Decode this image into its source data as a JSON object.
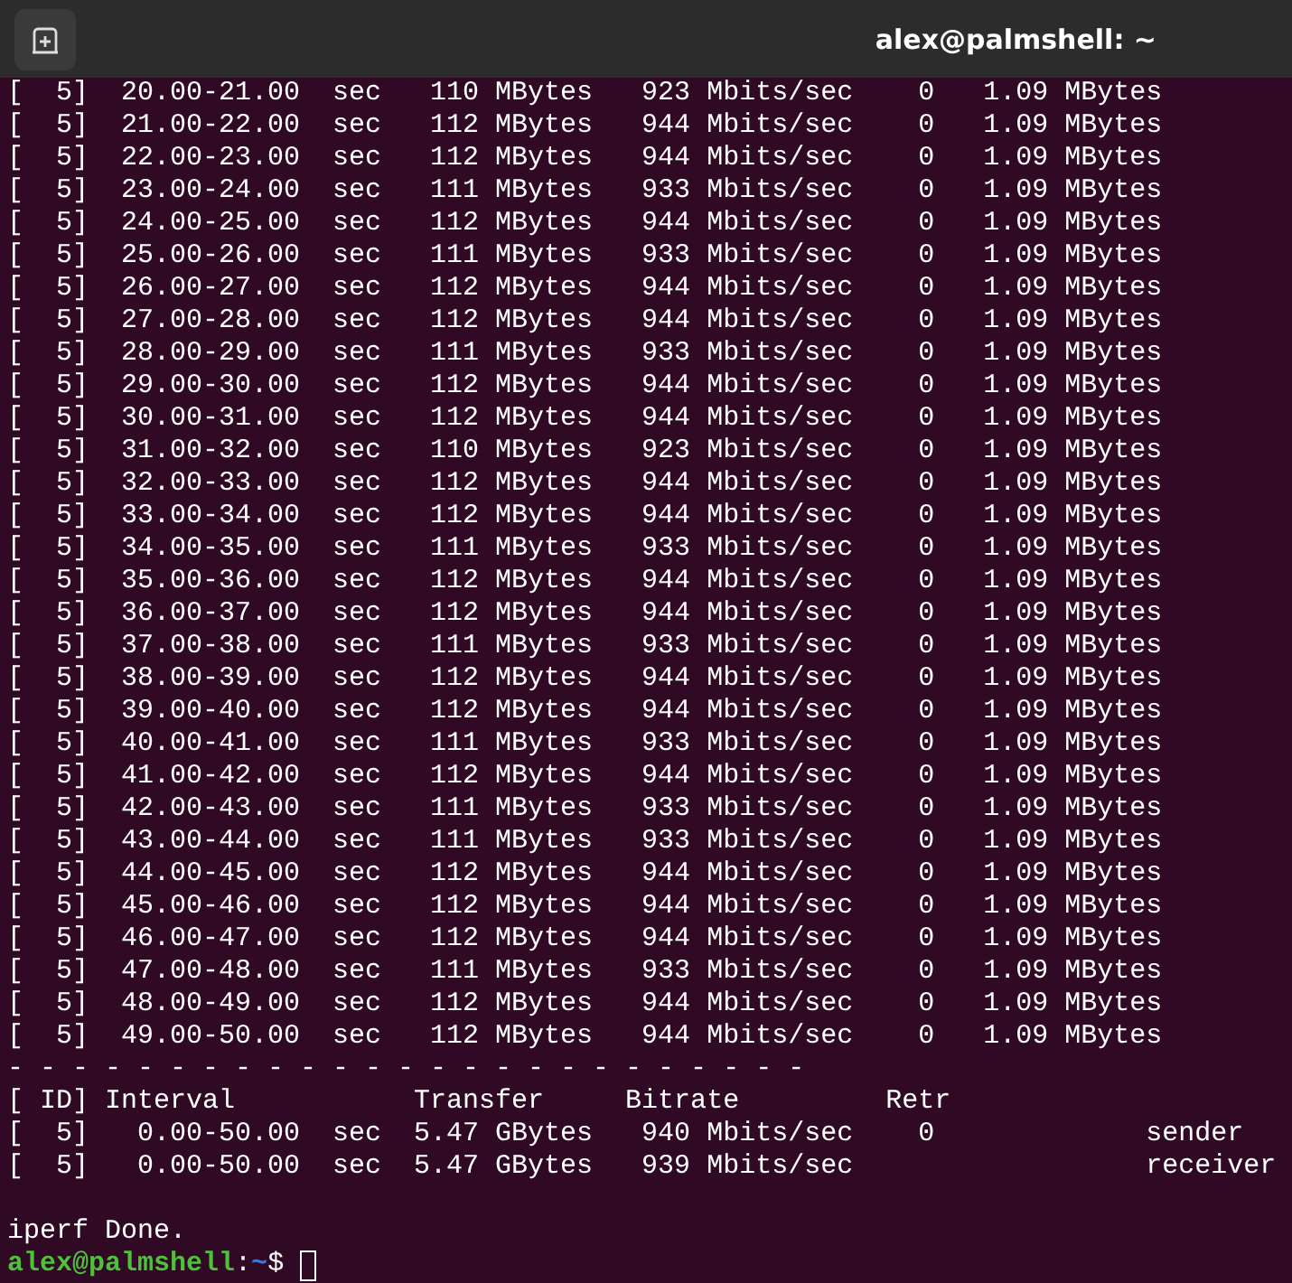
{
  "window": {
    "title": "alex@palmshell: ~"
  },
  "terminal": {
    "lines": [
      {
        "kind": "output",
        "text": "[  5]  20.00-21.00  sec   110 MBytes   923 Mbits/sec    0   1.09 MBytes"
      },
      {
        "kind": "output",
        "text": "[  5]  21.00-22.00  sec   112 MBytes   944 Mbits/sec    0   1.09 MBytes"
      },
      {
        "kind": "output",
        "text": "[  5]  22.00-23.00  sec   112 MBytes   944 Mbits/sec    0   1.09 MBytes"
      },
      {
        "kind": "output",
        "text": "[  5]  23.00-24.00  sec   111 MBytes   933 Mbits/sec    0   1.09 MBytes"
      },
      {
        "kind": "output",
        "text": "[  5]  24.00-25.00  sec   112 MBytes   944 Mbits/sec    0   1.09 MBytes"
      },
      {
        "kind": "output",
        "text": "[  5]  25.00-26.00  sec   111 MBytes   933 Mbits/sec    0   1.09 MBytes"
      },
      {
        "kind": "output",
        "text": "[  5]  26.00-27.00  sec   112 MBytes   944 Mbits/sec    0   1.09 MBytes"
      },
      {
        "kind": "output",
        "text": "[  5]  27.00-28.00  sec   112 MBytes   944 Mbits/sec    0   1.09 MBytes"
      },
      {
        "kind": "output",
        "text": "[  5]  28.00-29.00  sec   111 MBytes   933 Mbits/sec    0   1.09 MBytes"
      },
      {
        "kind": "output",
        "text": "[  5]  29.00-30.00  sec   112 MBytes   944 Mbits/sec    0   1.09 MBytes"
      },
      {
        "kind": "output",
        "text": "[  5]  30.00-31.00  sec   112 MBytes   944 Mbits/sec    0   1.09 MBytes"
      },
      {
        "kind": "output",
        "text": "[  5]  31.00-32.00  sec   110 MBytes   923 Mbits/sec    0   1.09 MBytes"
      },
      {
        "kind": "output",
        "text": "[  5]  32.00-33.00  sec   112 MBytes   944 Mbits/sec    0   1.09 MBytes"
      },
      {
        "kind": "output",
        "text": "[  5]  33.00-34.00  sec   112 MBytes   944 Mbits/sec    0   1.09 MBytes"
      },
      {
        "kind": "output",
        "text": "[  5]  34.00-35.00  sec   111 MBytes   933 Mbits/sec    0   1.09 MBytes"
      },
      {
        "kind": "output",
        "text": "[  5]  35.00-36.00  sec   112 MBytes   944 Mbits/sec    0   1.09 MBytes"
      },
      {
        "kind": "output",
        "text": "[  5]  36.00-37.00  sec   112 MBytes   944 Mbits/sec    0   1.09 MBytes"
      },
      {
        "kind": "output",
        "text": "[  5]  37.00-38.00  sec   111 MBytes   933 Mbits/sec    0   1.09 MBytes"
      },
      {
        "kind": "output",
        "text": "[  5]  38.00-39.00  sec   112 MBytes   944 Mbits/sec    0   1.09 MBytes"
      },
      {
        "kind": "output",
        "text": "[  5]  39.00-40.00  sec   112 MBytes   944 Mbits/sec    0   1.09 MBytes"
      },
      {
        "kind": "output",
        "text": "[  5]  40.00-41.00  sec   111 MBytes   933 Mbits/sec    0   1.09 MBytes"
      },
      {
        "kind": "output",
        "text": "[  5]  41.00-42.00  sec   112 MBytes   944 Mbits/sec    0   1.09 MBytes"
      },
      {
        "kind": "output",
        "text": "[  5]  42.00-43.00  sec   111 MBytes   933 Mbits/sec    0   1.09 MBytes"
      },
      {
        "kind": "output",
        "text": "[  5]  43.00-44.00  sec   111 MBytes   933 Mbits/sec    0   1.09 MBytes"
      },
      {
        "kind": "output",
        "text": "[  5]  44.00-45.00  sec   112 MBytes   944 Mbits/sec    0   1.09 MBytes"
      },
      {
        "kind": "output",
        "text": "[  5]  45.00-46.00  sec   112 MBytes   944 Mbits/sec    0   1.09 MBytes"
      },
      {
        "kind": "output",
        "text": "[  5]  46.00-47.00  sec   112 MBytes   944 Mbits/sec    0   1.09 MBytes"
      },
      {
        "kind": "output",
        "text": "[  5]  47.00-48.00  sec   111 MBytes   933 Mbits/sec    0   1.09 MBytes"
      },
      {
        "kind": "output",
        "text": "[  5]  48.00-49.00  sec   112 MBytes   944 Mbits/sec    0   1.09 MBytes"
      },
      {
        "kind": "output",
        "text": "[  5]  49.00-50.00  sec   112 MBytes   944 Mbits/sec    0   1.09 MBytes"
      },
      {
        "kind": "output",
        "text": "- - - - - - - - - - - - - - - - - - - - - - - - -"
      },
      {
        "kind": "output",
        "text": "[ ID] Interval           Transfer     Bitrate         Retr"
      },
      {
        "kind": "output",
        "text": "[  5]   0.00-50.00  sec  5.47 GBytes   940 Mbits/sec    0             sender"
      },
      {
        "kind": "output",
        "text": "[  5]   0.00-50.00  sec  5.47 GBytes   939 Mbits/sec                  receiver"
      },
      {
        "kind": "blank"
      },
      {
        "kind": "output",
        "text": "iperf Done."
      }
    ],
    "prompt": {
      "user_host": "alex@palmshell",
      "separator": ":",
      "path": "~",
      "symbol": "$"
    }
  }
}
